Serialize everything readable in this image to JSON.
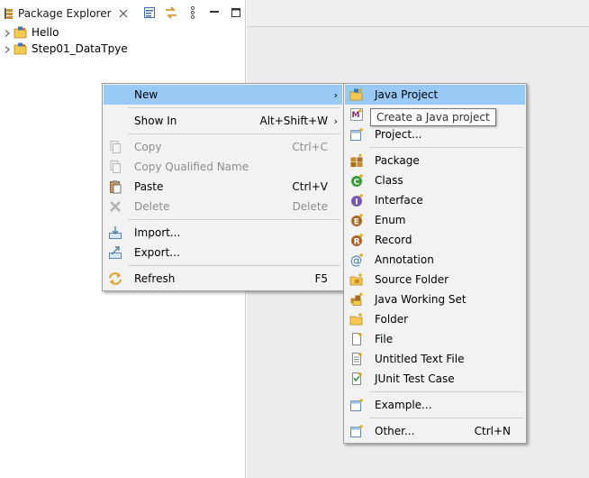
{
  "view": {
    "title": "Package Explorer"
  },
  "tree": [
    {
      "label": "Hello"
    },
    {
      "label": "Step01_DataTpye"
    }
  ],
  "context_menu": [
    {
      "label": "New",
      "arrow": "›",
      "highlighted": true
    },
    {
      "label": "Show In",
      "accel": "Alt+Shift+W",
      "arrow": "›"
    },
    {
      "label": "Copy",
      "accel": "Ctrl+C",
      "disabled": true
    },
    {
      "label": "Copy Qualified Name",
      "disabled": true
    },
    {
      "label": "Paste",
      "accel": "Ctrl+V"
    },
    {
      "label": "Delete",
      "accel": "Delete",
      "disabled": true
    },
    {
      "label": "Import..."
    },
    {
      "label": "Export..."
    },
    {
      "label": "Refresh",
      "accel": "F5"
    }
  ],
  "submenu": [
    {
      "label": "Java Project",
      "highlighted": true
    },
    {
      "label": "Project..."
    },
    {
      "label": "Package"
    },
    {
      "label": "Class"
    },
    {
      "label": "Interface"
    },
    {
      "label": "Enum"
    },
    {
      "label": "Record"
    },
    {
      "label": "Annotation"
    },
    {
      "label": "Source Folder"
    },
    {
      "label": "Java Working Set"
    },
    {
      "label": "Folder"
    },
    {
      "label": "File"
    },
    {
      "label": "Untitled Text File"
    },
    {
      "label": "JUnit Test Case"
    },
    {
      "label": "Example..."
    },
    {
      "label": "Other...",
      "accel": "Ctrl+N"
    }
  ],
  "tooltip": {
    "text": "Create a Java project"
  },
  "colors": {
    "highlight": "#99c9f5",
    "menu_bg": "#f2f2f2",
    "disabled": "#8d8d8d"
  }
}
